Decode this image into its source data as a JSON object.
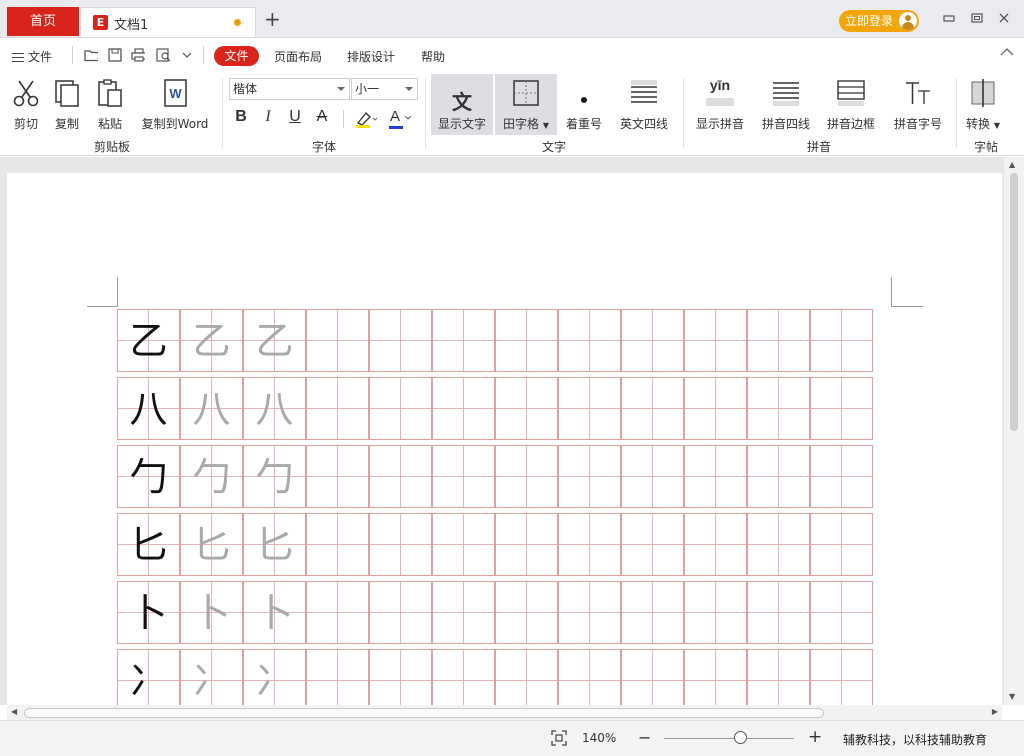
{
  "tabs": {
    "home": "首页",
    "document": "文档1",
    "add": "+"
  },
  "titlebar": {
    "login": "立即登录",
    "minimize": "▭",
    "restore": "▣",
    "close": "✕"
  },
  "menu": {
    "file": "文件",
    "tabs": [
      "文件",
      "页面布局",
      "排版设计",
      "帮助"
    ],
    "collapse": "︿"
  },
  "ribbon": {
    "clipboard": {
      "group": "剪贴板",
      "cut": "剪切",
      "copy": "复制",
      "paste": "粘贴",
      "copy_to_word": "复制到Word"
    },
    "font": {
      "group": "字体",
      "family": "楷体",
      "size": "小一",
      "bold": "B",
      "italic": "I",
      "underline": "U",
      "strike": "A",
      "font_color": "A"
    },
    "text": {
      "group": "文字",
      "show_text": "显示文字",
      "show_text_icon": "文",
      "tianzige": "田字格",
      "emphasis": "着重号",
      "four_line": "英文四线"
    },
    "pinyin": {
      "group": "拼音",
      "show_pinyin": "显示拼音",
      "pinyin_sample": "yīn",
      "four_line": "拼音四线",
      "border": "拼音边框",
      "size": "拼音字号"
    },
    "copybook": {
      "group": "字帖",
      "convert": "转换"
    }
  },
  "document": {
    "rows": [
      {
        "char": "乙"
      },
      {
        "char": "八"
      },
      {
        "char": "勹"
      },
      {
        "char": "匕"
      },
      {
        "char": "卜"
      },
      {
        "char": "冫"
      }
    ],
    "columns": 12,
    "trace_copies": 2
  },
  "status": {
    "zoom": "140%",
    "zoom_level": 140,
    "zoom_out": "−",
    "zoom_in": "+",
    "brand": "辅教科技，以科技辅助教育"
  },
  "colors": {
    "accent": "#d9241c",
    "login": "#f2a60c",
    "grid_line": "#e0a0a0",
    "trace_text": "#a9a9a9"
  }
}
